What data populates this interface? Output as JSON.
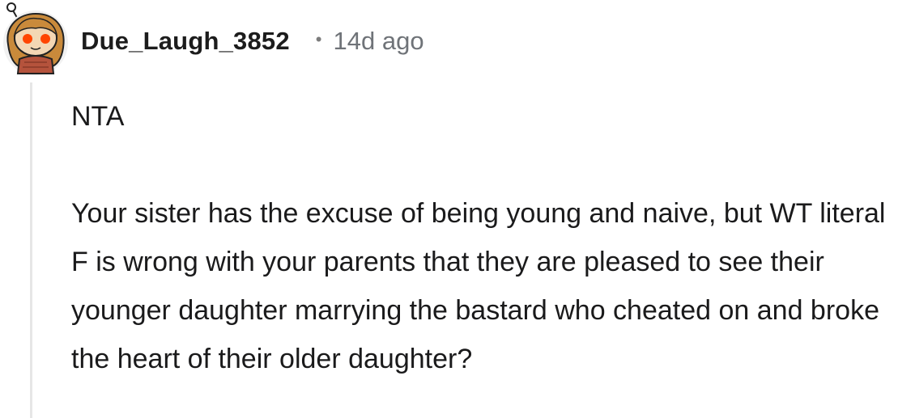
{
  "comment": {
    "username": "Due_Laugh_3852",
    "separator": "•",
    "timestamp": "14d ago",
    "avatar_icon": "snoo-avatar-icon",
    "body": {
      "verdict": "NTA",
      "paragraph": "Your sister has the excuse of being young and naive, but WT literal F is wrong with your parents that they are pleased to see their younger daughter marrying the bastard who cheated on and broke the heart of their older daughter?"
    },
    "colors": {
      "username": "#1c1c1c",
      "timestamp": "#6f7378",
      "thread_line": "#e6e6e6",
      "avatar_face": "#f3d7b4",
      "avatar_hair": "#c98a3b",
      "avatar_eyes": "#ff4500"
    }
  }
}
